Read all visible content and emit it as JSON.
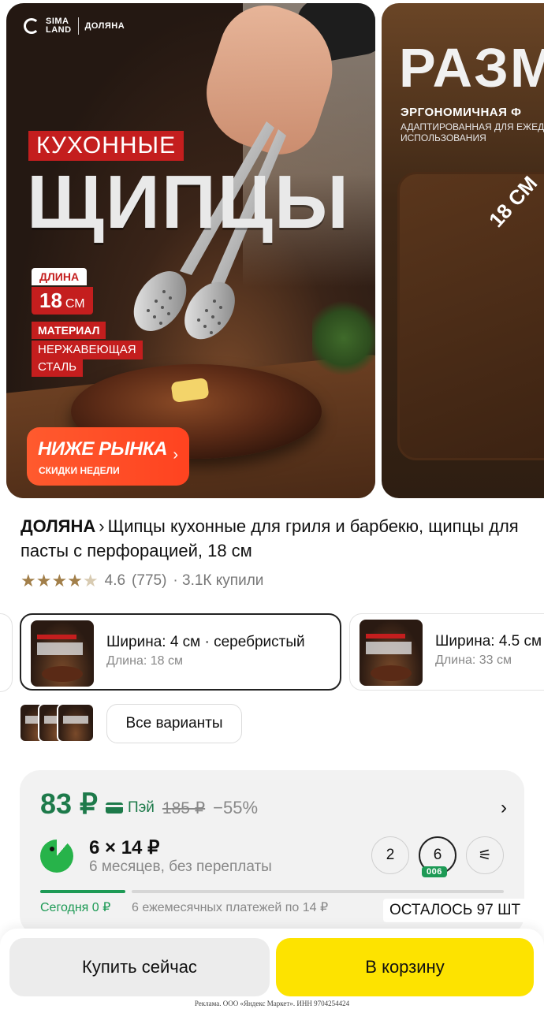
{
  "gallery": {
    "slide1": {
      "brand_sima": "SIMA\nLAND",
      "brand_name": "ДОЛЯНА",
      "headline_small": "КУХОННЫЕ",
      "headline_big": "ЩИПЦЫ",
      "length_label": "ДЛИНА",
      "length_value": "18",
      "length_unit": "СМ",
      "material_label": "МАТЕРИАЛ",
      "material_line1": "НЕРЖАВЕЮЩАЯ",
      "material_line2": "СТАЛЬ",
      "promo_title": "НИЖЕ РЫНКА",
      "promo_subtitle": "СКИДКИ НЕДЕЛИ",
      "promo_chevron": "›"
    },
    "slide2": {
      "title": "РАЗМ",
      "subtitle1": "ЭРГОНОМИЧНАЯ Ф",
      "subtitle2": "АДАПТИРОВАННАЯ ДЛЯ ЕЖЕД ИСПОЛЬЗОВАНИЯ",
      "size_label": "18 СМ"
    }
  },
  "product": {
    "brand": "ДОЛЯНА",
    "chevron": "›",
    "title": "Щипцы кухонные для гриля и барбекю, щипцы для пасты с перфорацией, 18 см",
    "rating": "4.6",
    "reviews": "(775)",
    "bought": "· 3.1К купили",
    "stars_full": "★★★★",
    "stars_half": "★"
  },
  "variants": {
    "selected": {
      "title": "Ширина: 4 см · серебристый",
      "subtitle": "Длина: 18 см"
    },
    "other": {
      "title": "Ширина: 4.5 см",
      "subtitle": "Длина: 33 см"
    },
    "all_label": "Все варианты"
  },
  "price": {
    "current": "83 ₽",
    "pay_label": "Пэй",
    "old": "185 ₽",
    "discount": "−55%",
    "chevron": "›",
    "split_main": "6 × 14 ₽",
    "split_sub": "6 месяцев, без переплаты",
    "options": [
      "2",
      "6"
    ],
    "selected_tag": "006",
    "filter_icon": "⚟",
    "today": "Сегодня 0 ₽",
    "monthly": "6 ежемесячных платежей по 14 ₽",
    "payment_progress": 0.18,
    "remaining": "ОСТАЛОСЬ 97 ШТ"
  },
  "actions": {
    "buy_now": "Купить сейчас",
    "add_to_cart": "В корзину"
  },
  "ad_line": "Реклама. ООО «Яндекс Маркет». ИНН 9704254424",
  "colors": {
    "accent_green": "#1d9a55",
    "price_green": "#1d7a4a",
    "cart_yellow": "#fde300",
    "promo_red": "#c41e1e",
    "promo_orange": "#ff4f28"
  }
}
